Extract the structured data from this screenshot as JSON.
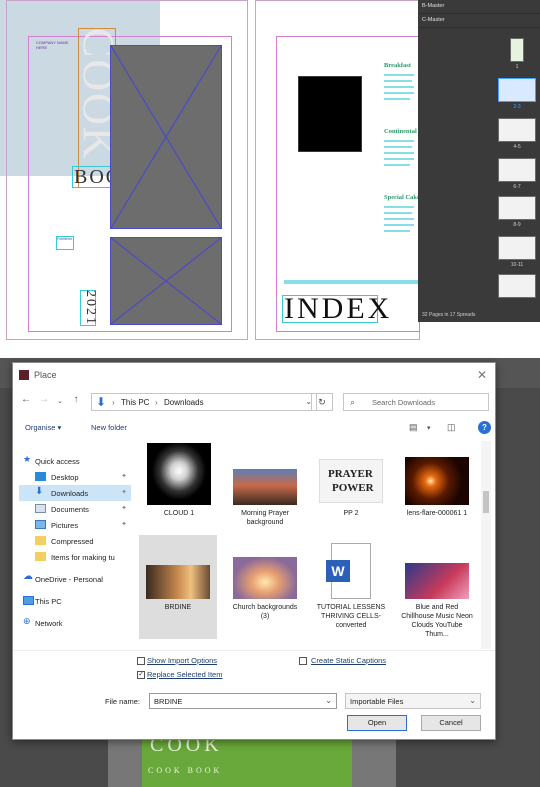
{
  "layout_panel": {
    "cover": {
      "title_vertical": "COOK",
      "title_book": "BOOK",
      "year": "2021",
      "tiny_label_top": "COMPANY NAME HERE",
      "tiny_label_side": "Published"
    },
    "index_page": {
      "title": "INDEX",
      "sections": [
        "Breakfast",
        "Continental",
        "Special Cake"
      ]
    },
    "pages_panel": {
      "masters": [
        "B-Master",
        "C-Master"
      ],
      "spreads": [
        "1",
        "2-3",
        "4-5",
        "6-7",
        "8-9",
        "10-11"
      ],
      "footer": "32 Pages in 17 Spreads"
    }
  },
  "dialog": {
    "title": "Place",
    "breadcrumb": [
      "This PC",
      "Downloads"
    ],
    "search_placeholder": "Search Downloads",
    "toolbar": {
      "organise": "Organise ▾",
      "new_folder": "New folder",
      "help": "?"
    },
    "sidebar": [
      {
        "label": "Quick access",
        "icon": "star-icon",
        "pinned": false,
        "selected": false
      },
      {
        "label": "Desktop",
        "icon": "desktop-icon",
        "pinned": true,
        "selected": false
      },
      {
        "label": "Downloads",
        "icon": "download-icon",
        "pinned": true,
        "selected": true
      },
      {
        "label": "Documents",
        "icon": "documents-icon",
        "pinned": true,
        "selected": false
      },
      {
        "label": "Pictures",
        "icon": "pictures-icon",
        "pinned": true,
        "selected": false
      },
      {
        "label": "Compressed",
        "icon": "folder-icon",
        "pinned": false,
        "selected": false
      },
      {
        "label": "Items for making tu",
        "icon": "folder-icon",
        "pinned": false,
        "selected": false
      },
      {
        "label": "OneDrive - Personal",
        "icon": "cloud-icon",
        "pinned": false,
        "selected": false
      },
      {
        "label": "This PC",
        "icon": "pc-icon",
        "pinned": false,
        "selected": false
      },
      {
        "label": "Network",
        "icon": "network-icon",
        "pinned": false,
        "selected": false
      }
    ],
    "files": [
      {
        "name": "CLOUD 1",
        "thumb": "cloud",
        "selected": false
      },
      {
        "name": "Morning Prayer background",
        "thumb": "crowd",
        "selected": false
      },
      {
        "name": "PP 2",
        "thumb": "prayer-text",
        "selected": false
      },
      {
        "name": "lens-flare-000061 1",
        "thumb": "lens-flare",
        "selected": false
      },
      {
        "name": "BRDINE",
        "thumb": "silhouette",
        "selected": true
      },
      {
        "name": "Church backgrounds (3)",
        "thumb": "sky",
        "selected": false
      },
      {
        "name": "TUTORIAL LESSENS THRIVING CELLS-converted",
        "thumb": "word",
        "selected": false
      },
      {
        "name": "Blue and Red Chillhouse Music Neon Clouds YouTube Thum...",
        "thumb": "youtube",
        "selected": false
      }
    ],
    "prayer_thumb_text": [
      "PRAYER",
      "POWER"
    ],
    "word_thumb_letter": "W",
    "options": {
      "show_import": {
        "label": "Show Import Options",
        "checked": false
      },
      "replace_selected": {
        "label": "Replace Selected Item",
        "checked": true
      },
      "create_static": {
        "label": "Create Static Captions",
        "checked": false
      }
    },
    "file_name_label": "File name:",
    "file_name_value": "BRDINE",
    "file_type": "Importable Files",
    "open_label": "Open",
    "cancel_label": "Cancel"
  },
  "background_cover": {
    "big": "COOK",
    "small": "COOK BOOK"
  },
  "colors": {
    "accent": "#2b6fd6",
    "frame": "#4a4aca",
    "cover_green": "#69a83a"
  }
}
